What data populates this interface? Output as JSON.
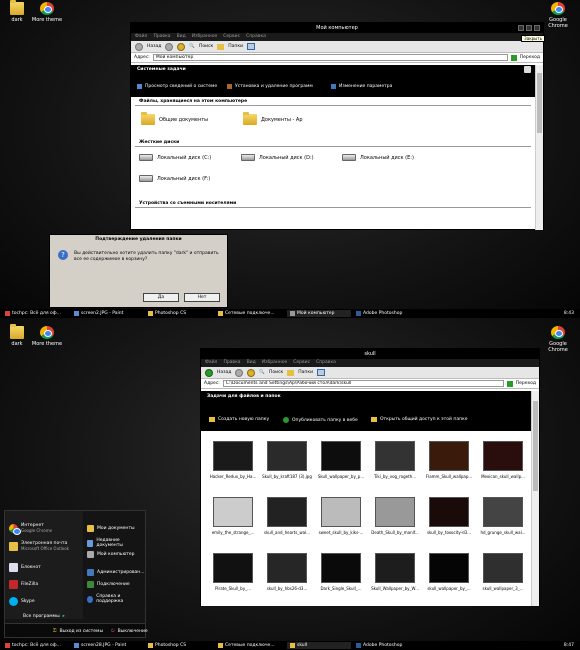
{
  "desktop1": {
    "icons": [
      "dark",
      "More theme",
      "Google Chrome"
    ]
  },
  "window1": {
    "title": "Мой компьютер",
    "menu": [
      "Файл",
      "Правка",
      "Вид",
      "Избранное",
      "Сервис",
      "Справка"
    ],
    "toolbar": {
      "back": "Назад",
      "search": "Поиск",
      "folders": "Папки"
    },
    "tooltip": "Закрыть",
    "address_label": "Адрес:",
    "address": "Мой компьютер",
    "go": "Переход",
    "system_tasks": "Системные задачи",
    "tasks": [
      "Просмотр сведений о системе",
      "Установка и удаление программ",
      "Изменение параметра"
    ],
    "shared_header": "Файлы, хранящиеся на этом компьютере",
    "shared": [
      "Общие документы",
      "Документы - Ар"
    ],
    "drives_header": "Жесткие диски",
    "drives": [
      "Локальный диск (C:)",
      "Локальный диск (D:)",
      "Локальный диск (E:)",
      "Локальный диск (F:)"
    ],
    "removable_header": "Устройства со съемными носителями"
  },
  "dialog": {
    "title": "Подтверждение удаления папки",
    "message": "Вы действительно хотите удалить папку \"dark\" и отправить все ее содержимое в корзину?",
    "yes": "Да",
    "no": "Нет"
  },
  "taskbar1": {
    "items": [
      "tochpc: Всё для оф...",
      "screen2.JPG - Paint",
      "Photoshop CS",
      "Сетевые подключе...",
      "Мой компьютер",
      "Adobe Photoshop"
    ],
    "clock": "8:43"
  },
  "desktop2": {
    "icons": [
      "dark",
      "More theme",
      "Google Chrome"
    ]
  },
  "window2": {
    "title": "skull",
    "menu": [
      "Файл",
      "Правка",
      "Вид",
      "Избранное",
      "Сервис",
      "Справка"
    ],
    "toolbar": {
      "back": "Назад",
      "search": "Поиск",
      "folders": "Папки"
    },
    "address_label": "Адрес:",
    "address": "C:\\Documents and Settings\\Ар\\Рабочий стол\\dark\\skull",
    "go": "Переход",
    "tasks_header": "Задачи для файлов и папок",
    "tasks": [
      "Создать новую папку",
      "Опубликовать папку в вебе",
      "Открыть общий доступ к этой папке"
    ],
    "files": [
      "Hacker_Redux_by_Ha...",
      "Skull_by_kraft187 (3).jpg",
      "Skull_wallpaper_by_p...",
      "Tiki_by_vog_rogeth...",
      "Flamm_Skull_wallpap...",
      "Mexican_skull_wallp...",
      "emily_the_strange_...",
      "skull_and_hearts_wal...",
      "sweet_skull_by_kiks-...",
      "Death_Skull_by_manif...",
      "skull_by_toxocity-d3...",
      "hd_grunge_skull_wal...",
      "Pirate_Skull_by_...",
      "skull_by_hbs26-d3...",
      "Dark_Single_Skull_...",
      "Skull_Wallpaper_by_W...",
      "skull_wallpaper_by_...",
      "skull_wallpaper_3_..."
    ]
  },
  "start_menu": {
    "pinned": [
      {
        "label": "Интернет",
        "sub": "Google Chrome"
      },
      {
        "label": "Электронная почта",
        "sub": "Microsoft Office Outlook"
      },
      {
        "label": "Блокнот",
        "sub": ""
      },
      {
        "label": "FileZilla",
        "sub": ""
      },
      {
        "label": "Skype",
        "sub": ""
      }
    ],
    "all_programs": "Все программы",
    "places": [
      "Мои документы",
      "Недавние документы",
      "Мой компьютер",
      "Администрирован...",
      "Подключение",
      "Справка и поддержка"
    ],
    "logoff": "Выход из системы",
    "shutdown": "Выключение"
  },
  "taskbar2": {
    "items": [
      "tochpc: Всё для оф...",
      "screen28.JPG - Paint",
      "Photoshop CS",
      "Сетевые подключе...",
      "skull",
      "Adobe Photoshop"
    ],
    "clock": "8:47"
  }
}
